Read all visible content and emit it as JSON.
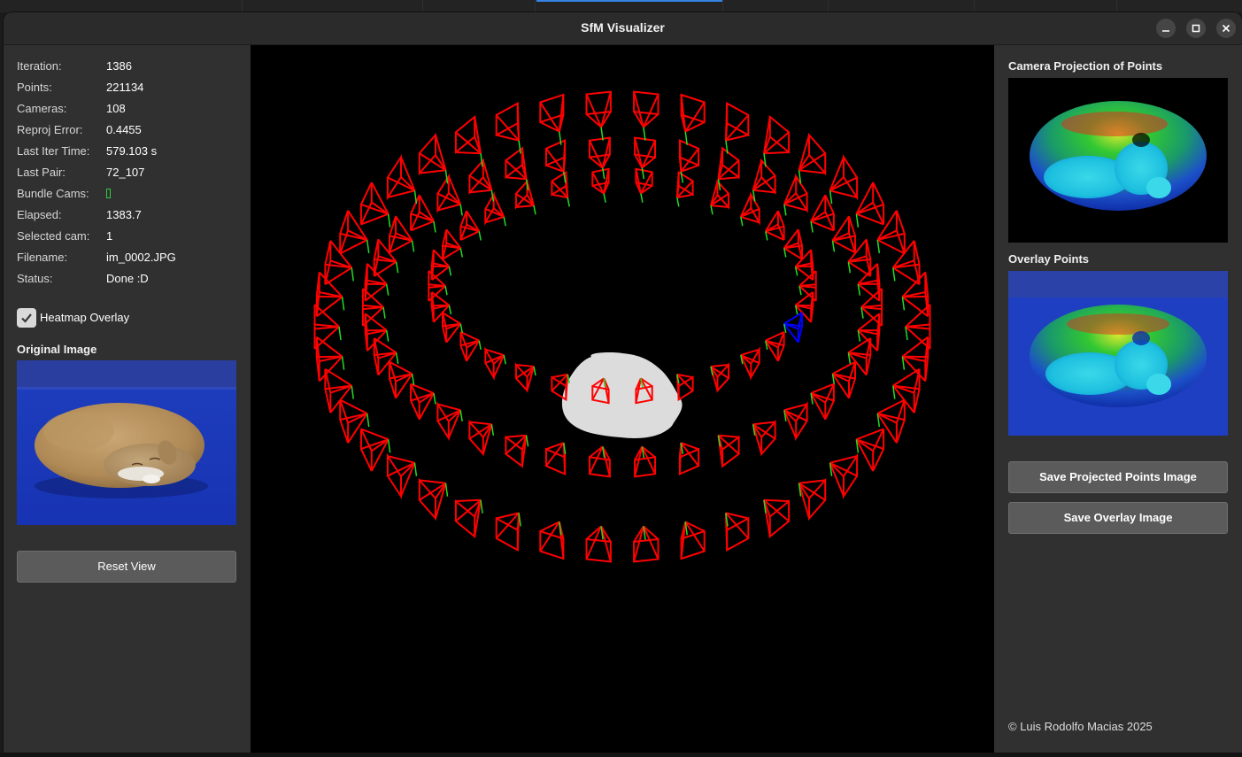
{
  "window": {
    "title": "SfM Visualizer",
    "controls": [
      "minimize-icon",
      "maximize-icon",
      "close-icon"
    ]
  },
  "stats": [
    {
      "key": "Iteration:",
      "value": "1386"
    },
    {
      "key": "Points:",
      "value": "221134"
    },
    {
      "key": "Cameras:",
      "value": "108"
    },
    {
      "key": "Reproj Error:",
      "value": "0.4455"
    },
    {
      "key": "Last Iter Time:",
      "value": "579.103 s"
    },
    {
      "key": "Last Pair:",
      "value": "72_107"
    },
    {
      "key": "Bundle Cams:",
      "value": ""
    },
    {
      "key": "Elapsed:",
      "value": "1383.7"
    },
    {
      "key": "Selected cam:",
      "value": "1"
    },
    {
      "key": "Filename:",
      "value": "im_0002.JPG"
    },
    {
      "key": "Status:",
      "value": "Done :D"
    }
  ],
  "heatmap": {
    "label": "Heatmap Overlay",
    "checked": true
  },
  "original_image": {
    "title": "Original Image"
  },
  "reset_button": {
    "label": "Reset View"
  },
  "projection": {
    "title": "Camera Projection of Points"
  },
  "overlay": {
    "title": "Overlay Points"
  },
  "save_projected_button": {
    "label": "Save Projected Points Image"
  },
  "save_overlay_button": {
    "label": "Save Overlay Image"
  },
  "credit": "© Luis Rodolfo Macias 2025",
  "colors": {
    "camera": "#ff0000",
    "selected_camera": "#0000ff",
    "up_axis": "#22dd22",
    "point_cloud": "#dcdcdc",
    "panel_bg": "#303030",
    "viewport_bg": "#000000",
    "button_bg": "#5b5b5b",
    "bundle_marker": "#2ecc40"
  }
}
